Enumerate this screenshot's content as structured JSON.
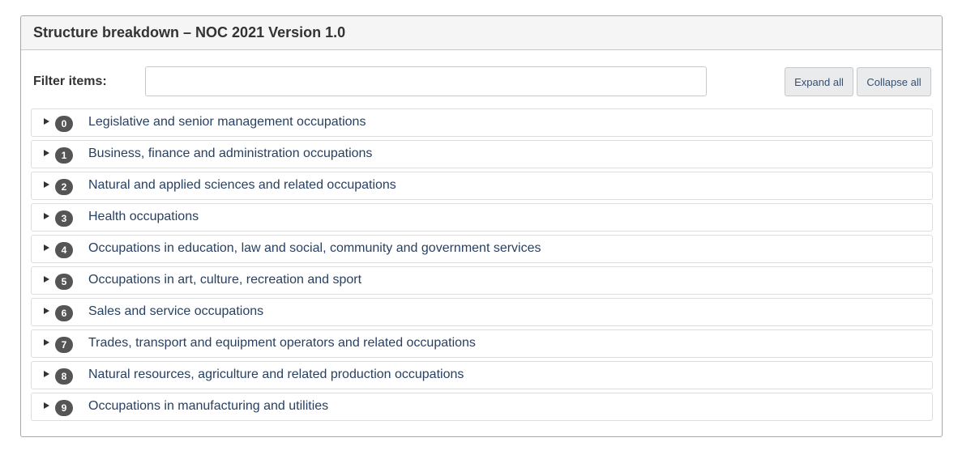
{
  "panel": {
    "title": "Structure breakdown – NOC 2021 Version 1.0"
  },
  "filter": {
    "label": "Filter items:",
    "value": "",
    "placeholder": ""
  },
  "buttons": {
    "expand_all": "Expand all",
    "collapse_all": "Collapse all"
  },
  "items": [
    {
      "code": "0",
      "label": "Legislative and senior management occupations",
      "icon": "caret-right-icon"
    },
    {
      "code": "1",
      "label": "Business, finance and administration occupations",
      "icon": "caret-right-icon"
    },
    {
      "code": "2",
      "label": "Natural and applied sciences and related occupations",
      "icon": "caret-right-icon"
    },
    {
      "code": "3",
      "label": "Health occupations",
      "icon": "caret-right-icon"
    },
    {
      "code": "4",
      "label": "Occupations in education, law and social, community and government services",
      "icon": "caret-right-icon"
    },
    {
      "code": "5",
      "label": "Occupations in art, culture, recreation and sport",
      "icon": "caret-right-icon"
    },
    {
      "code": "6",
      "label": "Sales and service occupations",
      "icon": "caret-right-icon"
    },
    {
      "code": "7",
      "label": "Trades, transport and equipment operators and related occupations",
      "icon": "caret-right-icon"
    },
    {
      "code": "8",
      "label": "Natural resources, agriculture and related production occupations",
      "icon": "caret-right-icon"
    },
    {
      "code": "9",
      "label": "Occupations in manufacturing and utilities",
      "icon": "caret-right-icon"
    }
  ],
  "colors": {
    "link_text": "#284162",
    "badge_bg": "#555555",
    "button_text": "#335075",
    "heading_bg": "#f5f5f5"
  }
}
